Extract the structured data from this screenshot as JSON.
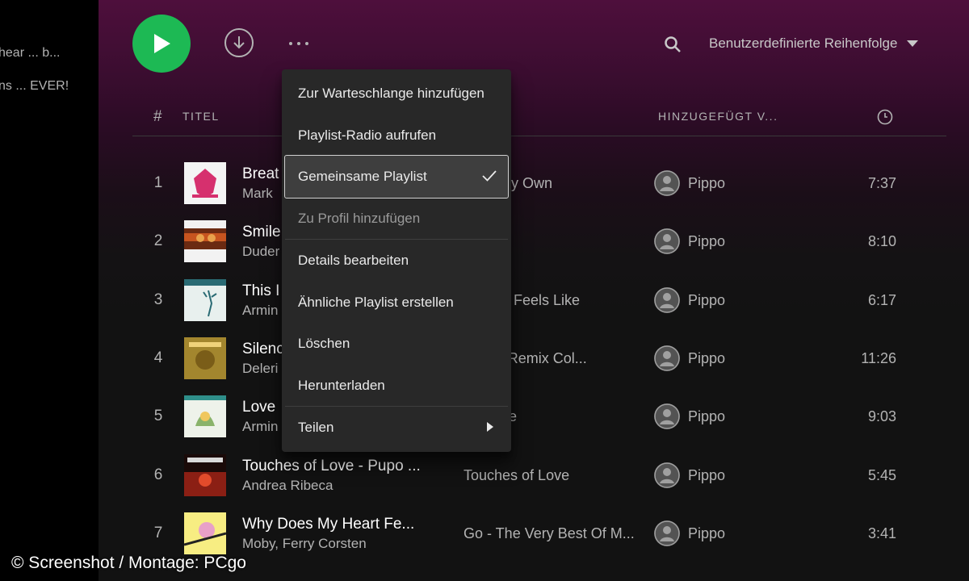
{
  "sidebar": {
    "items": [
      {
        "label": "hear ... b..."
      },
      {
        "label": "ns ... EVER!"
      }
    ]
  },
  "toolbar": {
    "play_icon": "play-icon",
    "download_icon": "download-icon",
    "more_icon": "more-icon",
    "search_icon": "search-icon",
    "sort_label": "Benutzerdefinierte Reihenfolge"
  },
  "colors": {
    "accent": "#1db954",
    "header_gradient": "#4e0f3c",
    "menu_background": "#282828"
  },
  "table": {
    "headers": {
      "number": "#",
      "title": "TITEL",
      "added_by": "HINZUGEFÜGT V...",
      "duration_icon": "clock-icon"
    },
    "rows": [
      {
        "num": "1",
        "title": "Breat",
        "artist": "Mark",
        "album": "e On My Own",
        "added_by": "Pippo",
        "duration": "7:37"
      },
      {
        "num": "2",
        "title": "Smile",
        "artist": "Duder",
        "album": "",
        "added_by": "Pippo",
        "duration": "8:10"
      },
      {
        "num": "3",
        "title": "This I",
        "artist": "Armin",
        "album": "What It Feels Like",
        "added_by": "Pippo",
        "duration": "6:17"
      },
      {
        "num": "4",
        "title": "Silenc",
        "artist": "Deleri",
        "album": "y: The Remix Col...",
        "added_by": "Pippo",
        "duration": "11:26"
      },
      {
        "num": "5",
        "title": "Love",
        "artist": "Armin",
        "album": "ou More",
        "added_by": "Pippo",
        "duration": "9:03"
      },
      {
        "num": "6",
        "title": "Touches of Love - Pupo ...",
        "artist": "Andrea Ribeca",
        "album": "Touches of Love",
        "added_by": "Pippo",
        "duration": "5:45"
      },
      {
        "num": "7",
        "title": "Why Does My Heart Fe...",
        "artist": "Moby, Ferry Corsten",
        "album": "Go - The Very Best Of M...",
        "added_by": "Pippo",
        "duration": "3:41"
      }
    ]
  },
  "context_menu": {
    "items": [
      {
        "label": "Zur Warteschlange hinzufügen"
      },
      {
        "label": "Playlist-Radio aufrufen"
      },
      {
        "label": "Gemeinsame Playlist"
      },
      {
        "label": "Zu Profil hinzufügen"
      },
      {
        "label": "Details bearbeiten"
      },
      {
        "label": "Ähnliche Playlist erstellen"
      },
      {
        "label": "Löschen"
      },
      {
        "label": "Herunterladen"
      },
      {
        "label": "Teilen"
      }
    ]
  },
  "watermark": "© Screenshot / Montage: PCgo"
}
